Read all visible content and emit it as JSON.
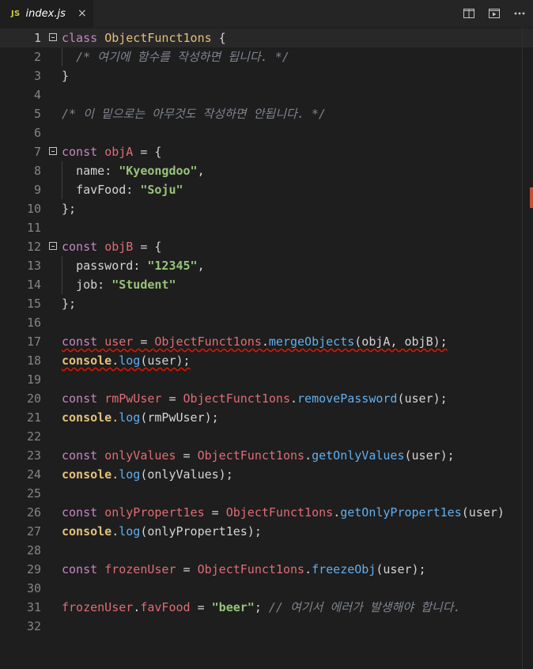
{
  "tab": {
    "icon_text": "JS",
    "title": "index.js",
    "close_glyph": "×"
  },
  "actions": [
    {
      "name": "split-editor-icon"
    },
    {
      "name": "open-preview-icon"
    },
    {
      "name": "more-actions-icon"
    }
  ],
  "colors": {
    "keyword": "#c586c0",
    "variable": "#e06c75",
    "class": "#e5c07b",
    "string": "#98c379",
    "function": "#61afef",
    "comment": "#7f848e",
    "error": "#e51400"
  },
  "editor": {
    "current_line": 1,
    "lines": [
      {
        "n": "1",
        "fold": true,
        "tokens": [
          {
            "t": "class",
            "c": "kw"
          },
          {
            "t": " "
          },
          {
            "t": "ObjectFunct1ons",
            "c": "cls"
          },
          {
            "t": " {"
          }
        ]
      },
      {
        "n": "2",
        "tokens": [
          {
            "t": "  "
          },
          {
            "t": "/* 여기에 함수를 작성하면 됩니다. */",
            "c": "cm"
          }
        ]
      },
      {
        "n": "3",
        "tokens": [
          {
            "t": "}"
          }
        ]
      },
      {
        "n": "4",
        "tokens": []
      },
      {
        "n": "5",
        "tokens": [
          {
            "t": "/* 이 밑으로는 아무것도 작성하면 안됩니다. */",
            "c": "cm"
          }
        ]
      },
      {
        "n": "6",
        "tokens": []
      },
      {
        "n": "7",
        "fold": true,
        "tokens": [
          {
            "t": "const",
            "c": "kw"
          },
          {
            "t": " "
          },
          {
            "t": "objA",
            "c": "var"
          },
          {
            "t": " = {"
          }
        ]
      },
      {
        "n": "8",
        "tokens": [
          {
            "t": "  "
          },
          {
            "t": "name",
            "c": "prop"
          },
          {
            "t": ": "
          },
          {
            "t": "\"Kyeongdoo\"",
            "c": "str"
          },
          {
            "t": ","
          }
        ]
      },
      {
        "n": "9",
        "tokens": [
          {
            "t": "  "
          },
          {
            "t": "favFood",
            "c": "prop"
          },
          {
            "t": ": "
          },
          {
            "t": "\"Soju\"",
            "c": "str"
          }
        ]
      },
      {
        "n": "10",
        "tokens": [
          {
            "t": "};"
          }
        ]
      },
      {
        "n": "11",
        "tokens": []
      },
      {
        "n": "12",
        "fold": true,
        "tokens": [
          {
            "t": "const",
            "c": "kw"
          },
          {
            "t": " "
          },
          {
            "t": "objB",
            "c": "var"
          },
          {
            "t": " = {"
          }
        ]
      },
      {
        "n": "13",
        "tokens": [
          {
            "t": "  "
          },
          {
            "t": "password",
            "c": "prop"
          },
          {
            "t": ": "
          },
          {
            "t": "\"12345\"",
            "c": "str"
          },
          {
            "t": ","
          }
        ]
      },
      {
        "n": "14",
        "tokens": [
          {
            "t": "  "
          },
          {
            "t": "job",
            "c": "prop"
          },
          {
            "t": ": "
          },
          {
            "t": "\"Student\"",
            "c": "str"
          }
        ]
      },
      {
        "n": "15",
        "tokens": [
          {
            "t": "};"
          }
        ]
      },
      {
        "n": "16",
        "tokens": []
      },
      {
        "n": "17",
        "tokens": [
          {
            "t": "const",
            "c": "kw sq"
          },
          {
            "t": " ",
            "c": "sq"
          },
          {
            "t": "user",
            "c": "var sq"
          },
          {
            "t": " = ",
            "c": "sq"
          },
          {
            "t": "ObjectFunct1ons",
            "c": "var sq"
          },
          {
            "t": ".",
            "c": "sq"
          },
          {
            "t": "mergeObjects",
            "c": "fn sq"
          },
          {
            "t": "(objA, objB);",
            "c": "sq"
          }
        ]
      },
      {
        "n": "18",
        "tokens": [
          {
            "t": "console",
            "c": "cls bold sq"
          },
          {
            "t": ".",
            "c": "sq"
          },
          {
            "t": "log",
            "c": "fn sq"
          },
          {
            "t": "(user);",
            "c": "sq"
          }
        ]
      },
      {
        "n": "19",
        "tokens": []
      },
      {
        "n": "20",
        "tokens": [
          {
            "t": "const",
            "c": "kw"
          },
          {
            "t": " "
          },
          {
            "t": "rmPwUser",
            "c": "var"
          },
          {
            "t": " = "
          },
          {
            "t": "ObjectFunct1ons",
            "c": "var"
          },
          {
            "t": "."
          },
          {
            "t": "removePassword",
            "c": "fn"
          },
          {
            "t": "(user);"
          }
        ]
      },
      {
        "n": "21",
        "tokens": [
          {
            "t": "console",
            "c": "cls bold"
          },
          {
            "t": "."
          },
          {
            "t": "log",
            "c": "fn"
          },
          {
            "t": "(rmPwUser);"
          }
        ]
      },
      {
        "n": "22",
        "tokens": []
      },
      {
        "n": "23",
        "tokens": [
          {
            "t": "const",
            "c": "kw"
          },
          {
            "t": " "
          },
          {
            "t": "onlyValues",
            "c": "var"
          },
          {
            "t": " = "
          },
          {
            "t": "ObjectFunct1ons",
            "c": "var"
          },
          {
            "t": "."
          },
          {
            "t": "getOnlyValues",
            "c": "fn"
          },
          {
            "t": "(user);"
          }
        ]
      },
      {
        "n": "24",
        "tokens": [
          {
            "t": "console",
            "c": "cls bold"
          },
          {
            "t": "."
          },
          {
            "t": "log",
            "c": "fn"
          },
          {
            "t": "(onlyValues);"
          }
        ]
      },
      {
        "n": "25",
        "tokens": []
      },
      {
        "n": "26",
        "tokens": [
          {
            "t": "const",
            "c": "kw"
          },
          {
            "t": " "
          },
          {
            "t": "onlyPropert1es",
            "c": "var"
          },
          {
            "t": " = "
          },
          {
            "t": "ObjectFunct1ons",
            "c": "var"
          },
          {
            "t": "."
          },
          {
            "t": "getOnlyPropert1es",
            "c": "fn"
          },
          {
            "t": "(user)"
          }
        ]
      },
      {
        "n": "27",
        "tokens": [
          {
            "t": "console",
            "c": "cls bold"
          },
          {
            "t": "."
          },
          {
            "t": "log",
            "c": "fn"
          },
          {
            "t": "(onlyPropert1es);"
          }
        ]
      },
      {
        "n": "28",
        "tokens": []
      },
      {
        "n": "29",
        "tokens": [
          {
            "t": "const",
            "c": "kw"
          },
          {
            "t": " "
          },
          {
            "t": "frozenUser",
            "c": "var"
          },
          {
            "t": " = "
          },
          {
            "t": "ObjectFunct1ons",
            "c": "var"
          },
          {
            "t": "."
          },
          {
            "t": "freezeObj",
            "c": "fn"
          },
          {
            "t": "(user);"
          }
        ]
      },
      {
        "n": "30",
        "tokens": []
      },
      {
        "n": "31",
        "tokens": [
          {
            "t": "frozenUser",
            "c": "var"
          },
          {
            "t": "."
          },
          {
            "t": "favFood",
            "c": "var"
          },
          {
            "t": " = "
          },
          {
            "t": "\"beer\"",
            "c": "str"
          },
          {
            "t": "; "
          },
          {
            "t": "// 여기서 에러가 발생해야 합니다.",
            "c": "cm"
          }
        ]
      },
      {
        "n": "32",
        "tokens": []
      }
    ]
  }
}
